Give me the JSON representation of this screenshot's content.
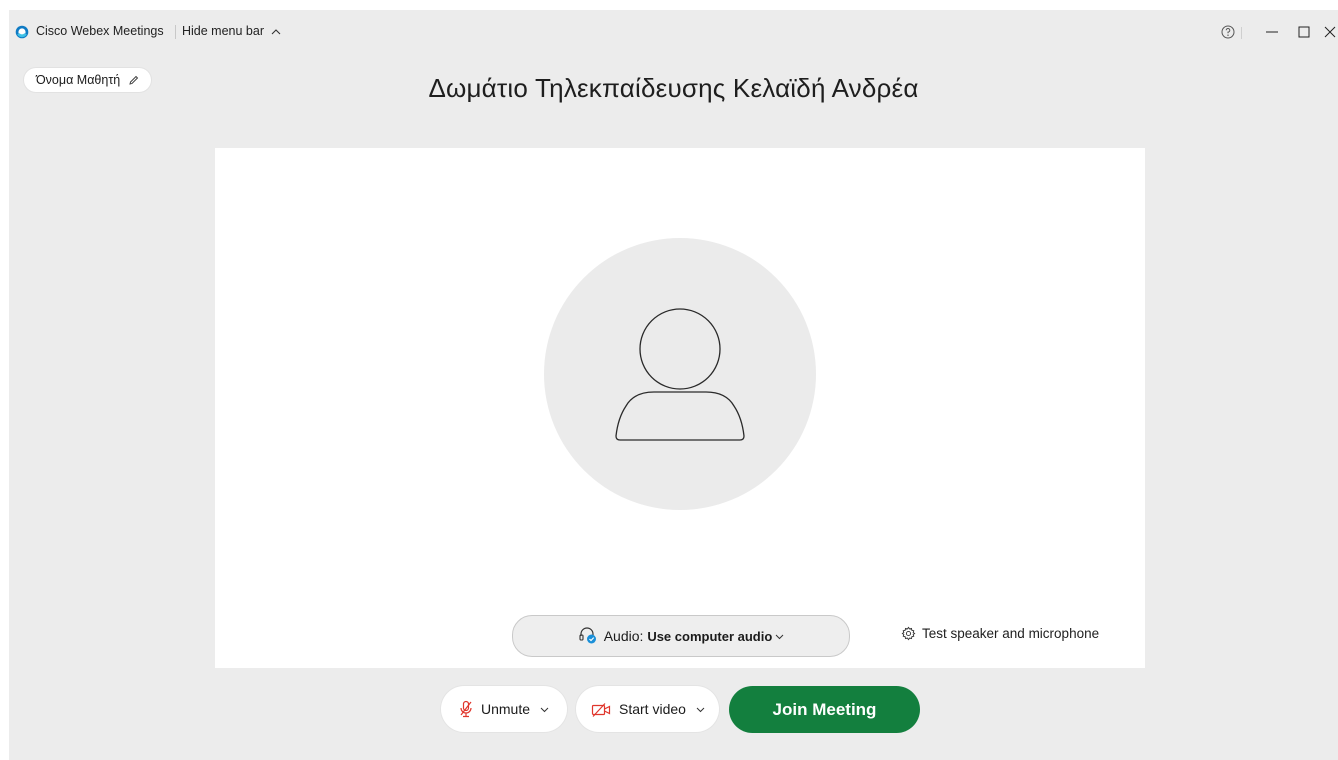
{
  "titlebar": {
    "app_name": "Cisco Webex Meetings",
    "hide_menu_label": "Hide menu bar",
    "help_icon": "help-circle-icon",
    "minimize_icon": "minimize-icon",
    "maximize_icon": "maximize-icon",
    "close_icon": "close-icon"
  },
  "user": {
    "name": "Όνομα Μαθητή",
    "edit_icon": "pencil-icon"
  },
  "meeting": {
    "title": "Δωμάτιο Τηλεκπαίδευσης Κελαϊδή Ανδρέα"
  },
  "audio": {
    "prefix": "Audio:",
    "value": "Use computer audio",
    "icon": "headset-icon"
  },
  "test_audio": {
    "label": "Test speaker and microphone",
    "icon": "gear-icon"
  },
  "controls": {
    "unmute_label": "Unmute",
    "unmute_icon": "microphone-muted-icon",
    "video_label": "Start video",
    "video_icon": "video-off-icon",
    "join_label": "Join Meeting"
  },
  "colors": {
    "accent_green": "#137f3e",
    "muted_red": "#e0362c",
    "logo_blue": "#0f7bc4",
    "background": "#ececec",
    "panel": "#ffffff"
  }
}
